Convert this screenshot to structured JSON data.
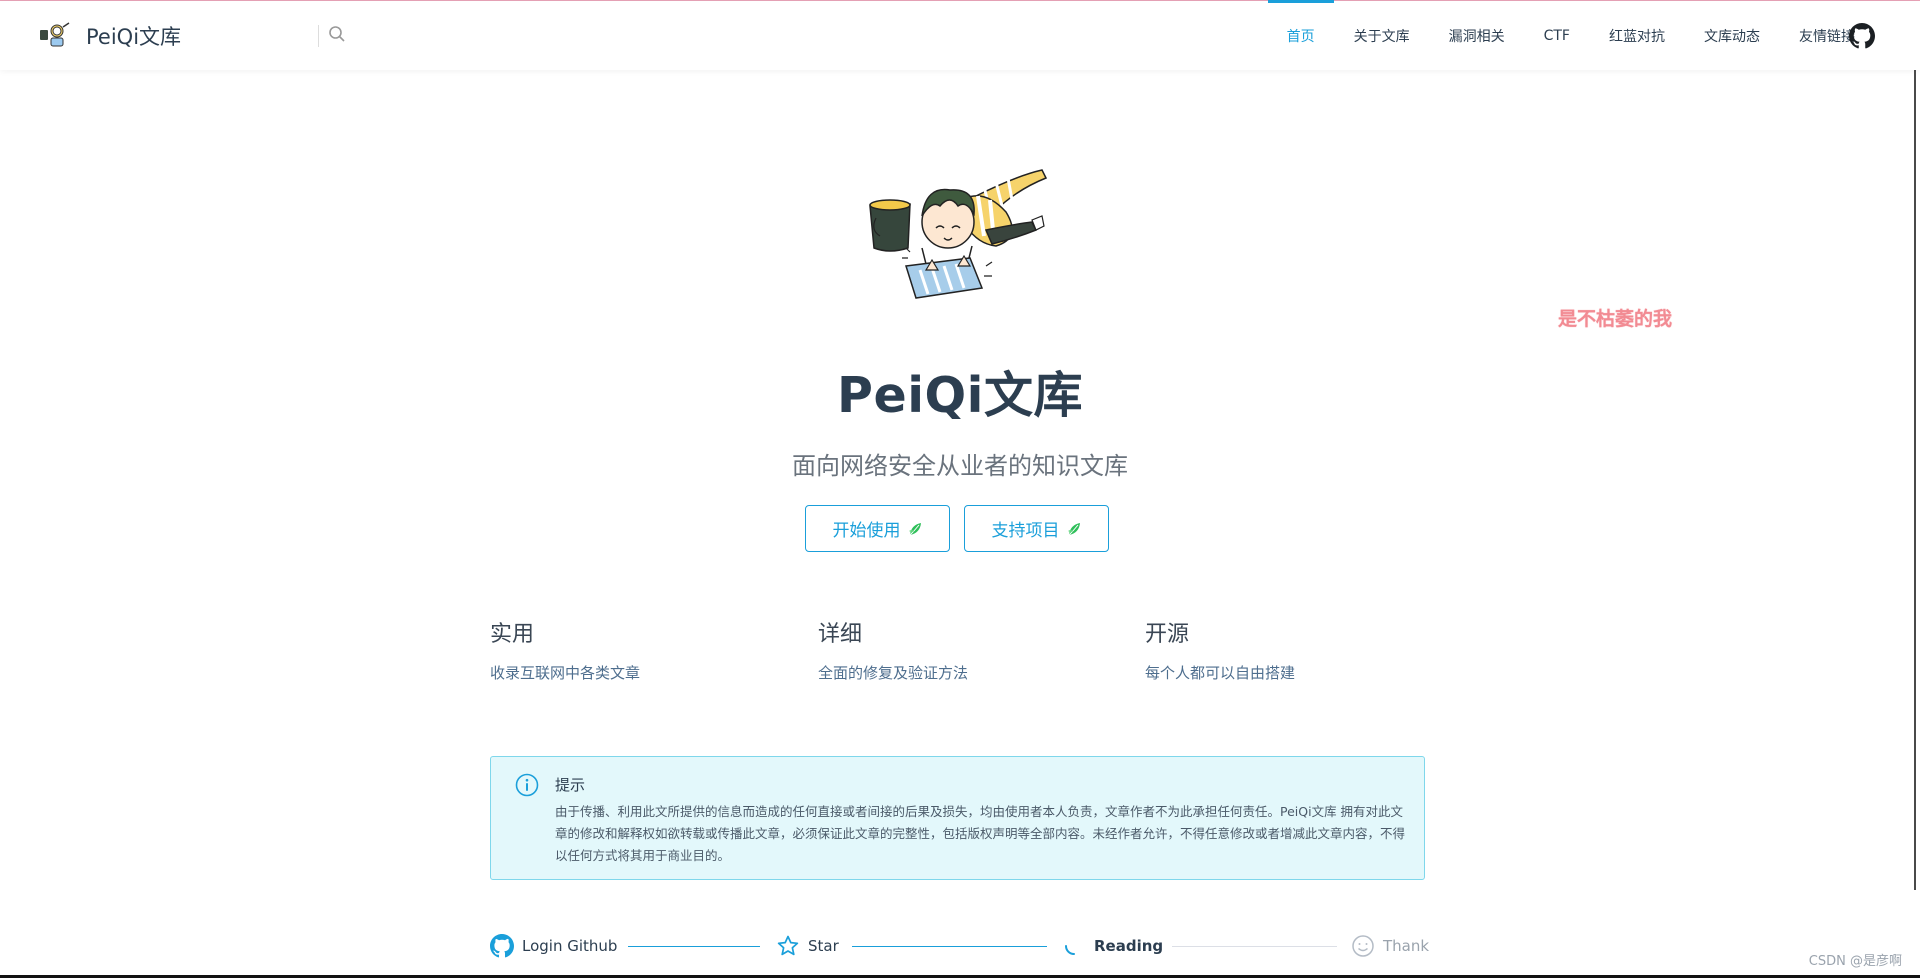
{
  "site": {
    "title": "PeiQi文库"
  },
  "nav": {
    "items": [
      {
        "label": "首页",
        "active": true
      },
      {
        "label": "关于文库",
        "active": false
      },
      {
        "label": "漏洞相关",
        "active": false
      },
      {
        "label": "CTF",
        "active": false
      },
      {
        "label": "红蓝对抗",
        "active": false
      },
      {
        "label": "文库动态",
        "active": false
      },
      {
        "label": "友情链接",
        "active": false
      }
    ],
    "github_icon": "github-icon"
  },
  "hero": {
    "title": "PeiQi文库",
    "description": "面向网络安全从业者的知识文库",
    "buttons": {
      "start": "开始使用",
      "support": "支持项目"
    }
  },
  "features": [
    {
      "title": "实用",
      "description": "收录互联网中各类文章"
    },
    {
      "title": "详细",
      "description": "全面的修复及验证方法"
    },
    {
      "title": "开源",
      "description": "每个人都可以自由搭建"
    }
  ],
  "tip": {
    "title": "提示",
    "body": "由于传播、利用此文所提供的信息而造成的任何直接或者间接的后果及损失，均由使用者本人负责，文章作者不为此承担任何责任。PeiQi文库 拥有对此文章的修改和解释权如欲转载或传播此文章，必须保证此文章的完整性，包括版权声明等全部内容。未经作者允许，不得任意修改或者增减此文章内容，不得以任何方式将其用于商业目的。"
  },
  "steps": [
    {
      "label": "Login Github",
      "icon": "github-icon"
    },
    {
      "label": "Star",
      "icon": "star-icon"
    },
    {
      "label": "Reading",
      "icon": "loading-icon"
    },
    {
      "label": "Thank",
      "icon": "smile-icon"
    }
  ],
  "overlay_text": "是不枯萎的我",
  "csdn_watermark": "CSDN @是彦啊",
  "colors": {
    "accent": "#1a9fda",
    "tip_bg": "#e3f8fb",
    "tip_border": "#7fd7eb",
    "overlay": "#f28b93"
  }
}
